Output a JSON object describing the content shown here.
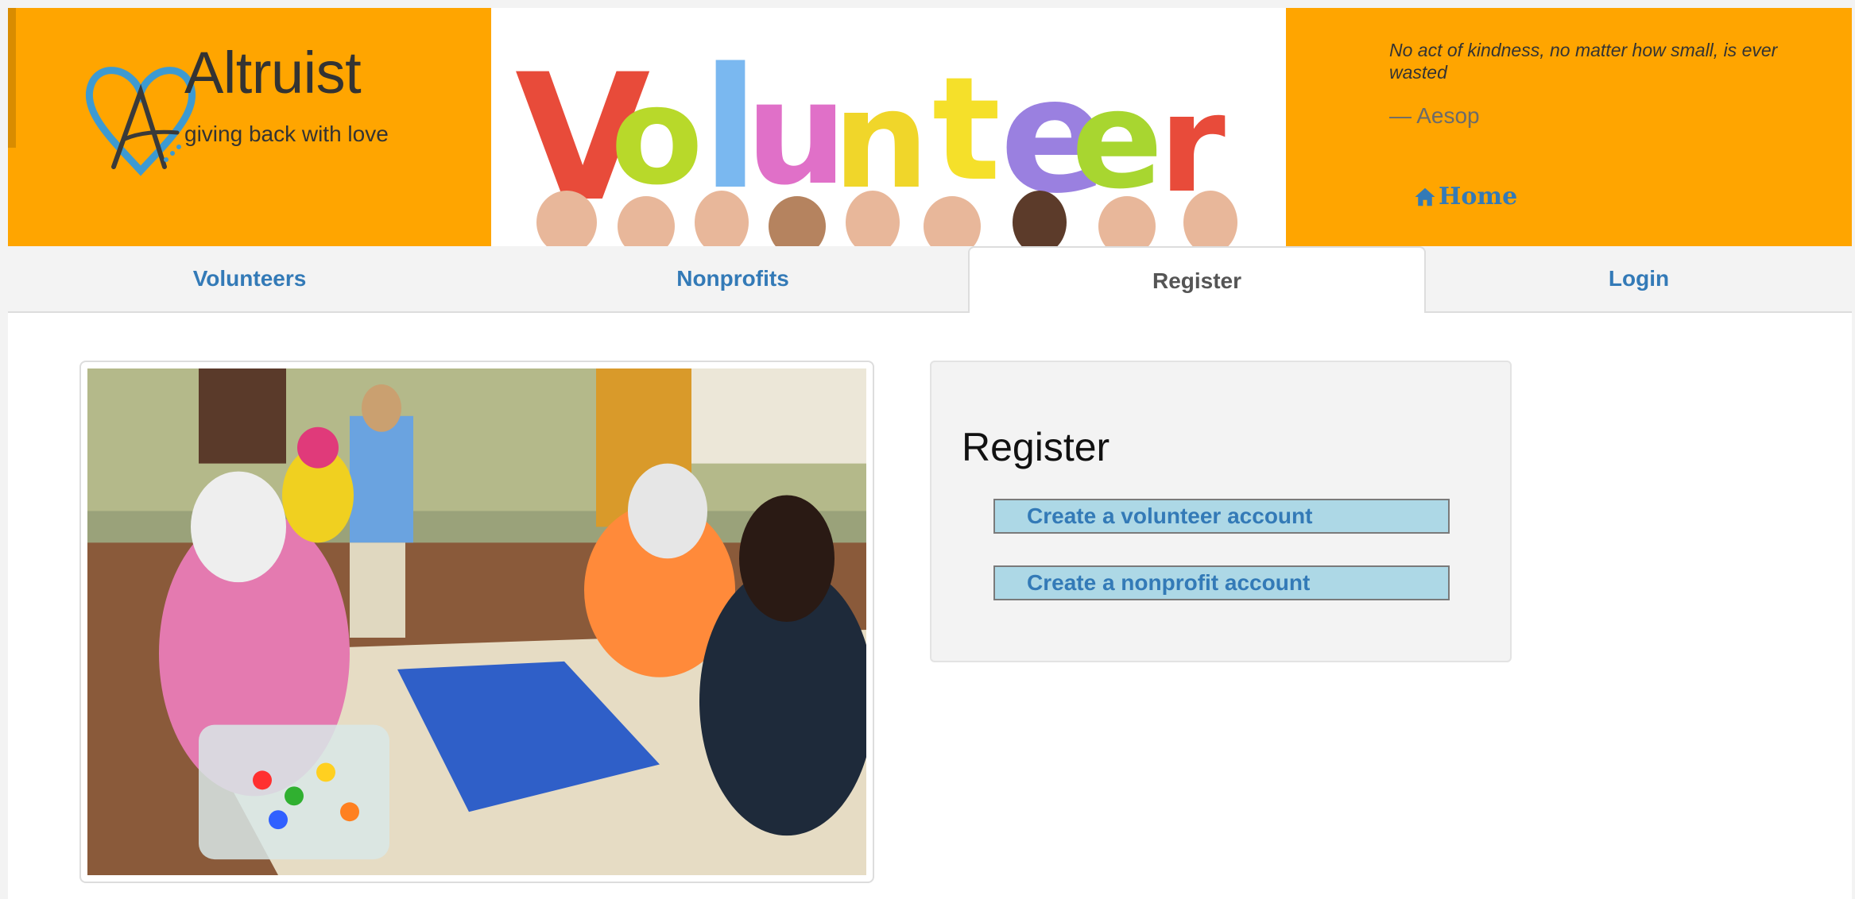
{
  "brand": {
    "title": "Altruist",
    "tagline": "giving back with love"
  },
  "hero": {
    "word": "Volunteer",
    "letter_colors": [
      "#e84b3a",
      "#b8d92a",
      "#7ab8f0",
      "#e070c8",
      "#f0d62a",
      "#f5e02a",
      "#9a80e0",
      "#a8d630",
      "#e84b3a",
      "#7ab8f0"
    ]
  },
  "quote": {
    "text": "No act of kindness, no matter how small, is ever wasted",
    "author": "— Aesop"
  },
  "home_link": {
    "label": "Home",
    "icon": "home-icon"
  },
  "tabs": [
    {
      "label": "Volunteers",
      "active": false
    },
    {
      "label": "Nonprofits",
      "active": false
    },
    {
      "label": "Register",
      "active": true
    },
    {
      "label": "Login",
      "active": false
    }
  ],
  "register": {
    "title": "Register",
    "volunteer_button": "Create a volunteer account",
    "nonprofit_button": "Create a nonprofit account"
  },
  "colors": {
    "banner": "#ffa500",
    "link": "#337ab7",
    "button_bg": "#add8e6"
  }
}
